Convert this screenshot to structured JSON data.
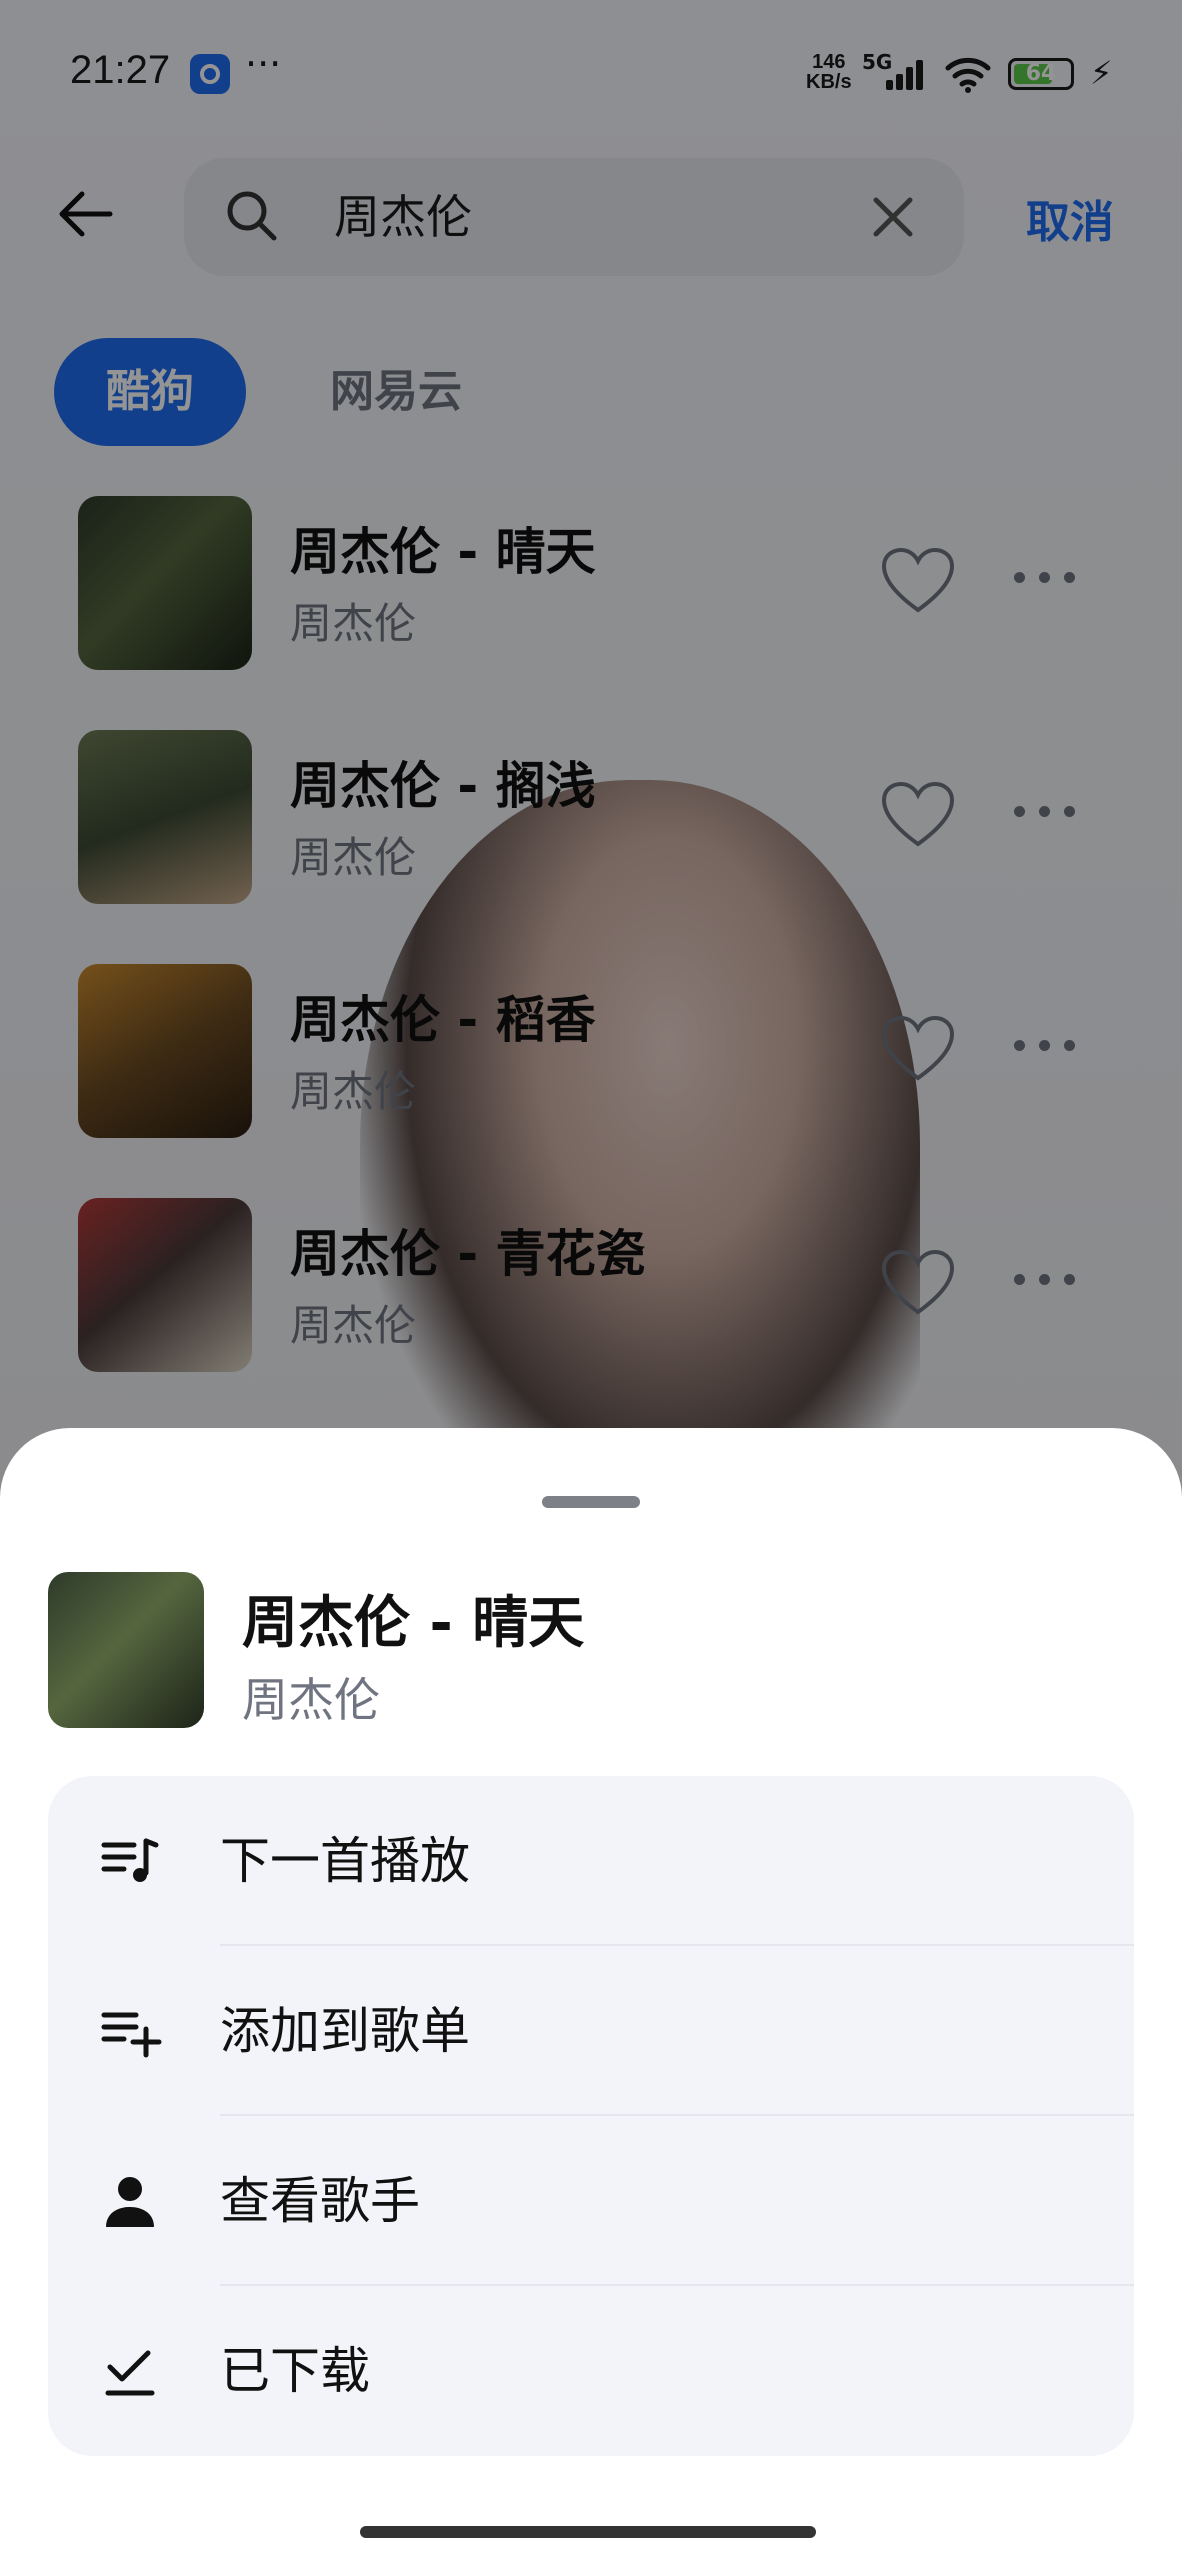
{
  "status_bar": {
    "time": "21:27",
    "more_dots": "···",
    "net_speed_value": "146",
    "net_speed_unit": "KB/s",
    "network": "5G",
    "battery": "64"
  },
  "search": {
    "query": "周杰伦",
    "cancel_label": "取消"
  },
  "source_tabs": [
    {
      "label": "酷狗",
      "active": true
    },
    {
      "label": "网易云",
      "active": false
    }
  ],
  "songs": [
    {
      "title": "周杰伦 - 晴天",
      "artist": "周杰伦"
    },
    {
      "title": "周杰伦 - 搁浅",
      "artist": "周杰伦"
    },
    {
      "title": "周杰伦 - 稻香",
      "artist": "周杰伦"
    },
    {
      "title": "周杰伦 - 青花瓷",
      "artist": "周杰伦"
    }
  ],
  "sheet": {
    "title": "周杰伦 - 晴天",
    "artist": "周杰伦",
    "actions": [
      {
        "label": "下一首播放",
        "icon": "play-next-icon"
      },
      {
        "label": "添加到歌单",
        "icon": "add-to-playlist-icon"
      },
      {
        "label": "查看歌手",
        "icon": "person-icon"
      },
      {
        "label": "已下载",
        "icon": "downloaded-check-icon"
      }
    ]
  },
  "colors": {
    "accent": "#1f6df0",
    "secondary_text": "#6f7480",
    "menu_bg": "#f2f4f9"
  }
}
